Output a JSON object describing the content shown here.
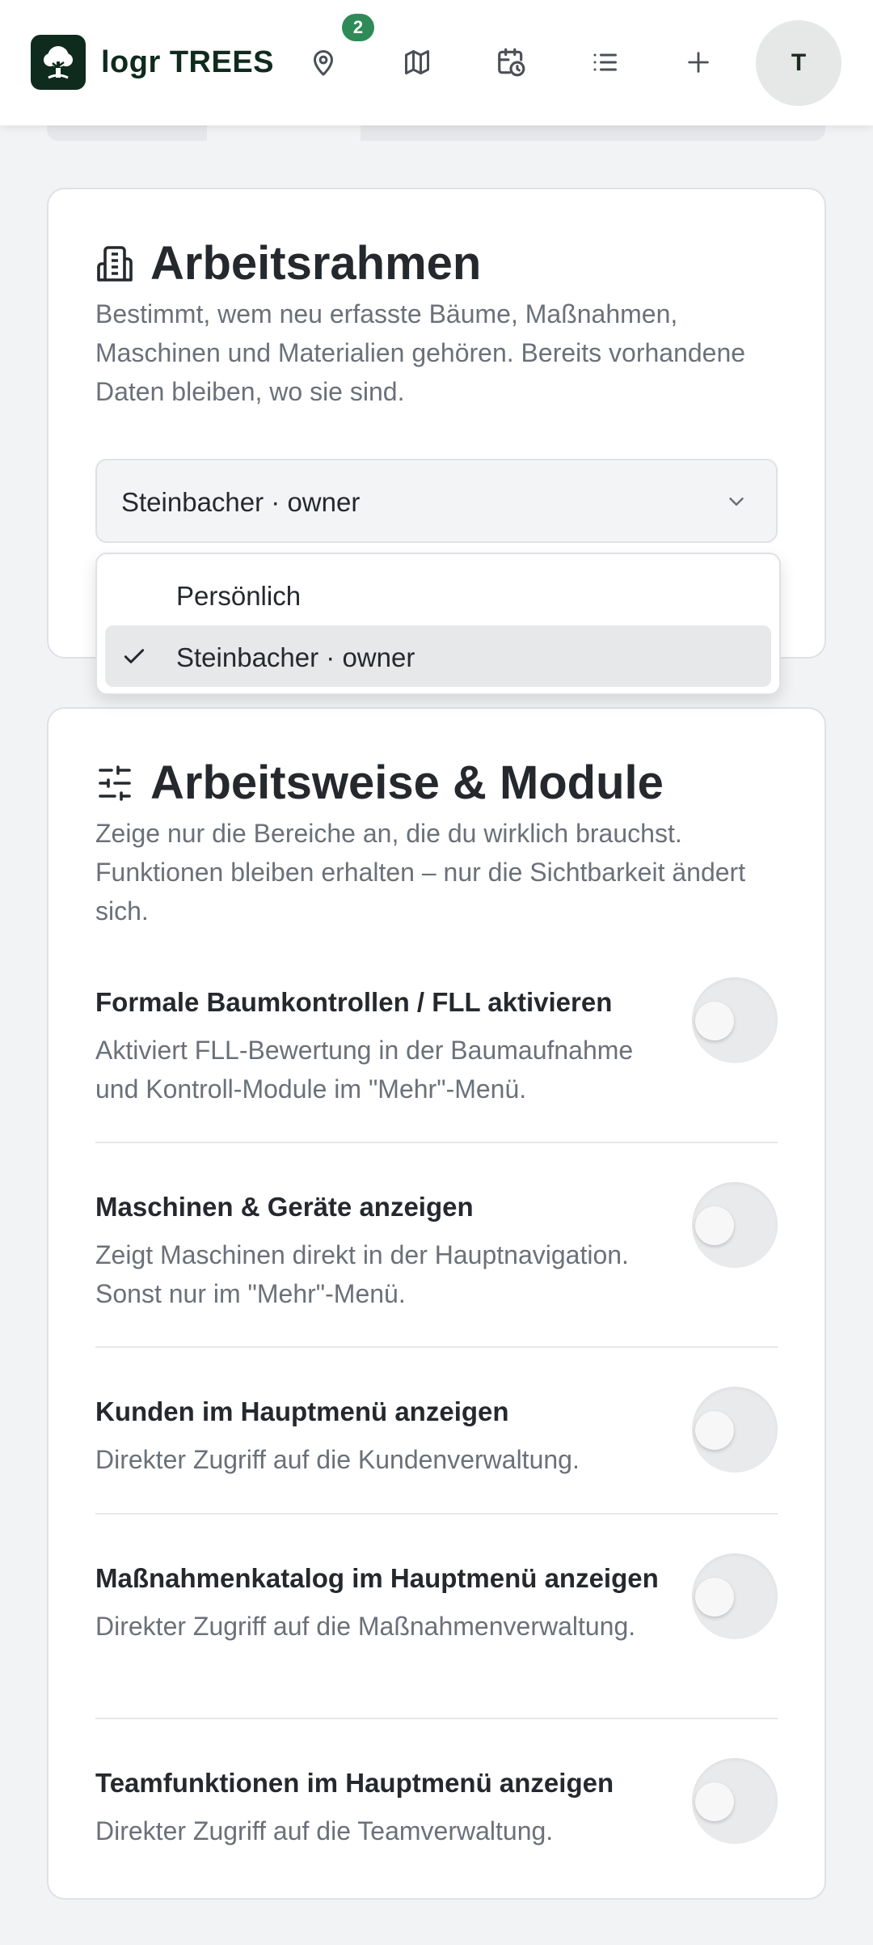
{
  "header": {
    "brand": "logr TREES",
    "badge_count": "2",
    "avatar_initial": "T",
    "nav_icons": [
      "map-pin-icon",
      "map-icon",
      "calendar-clock-icon",
      "list-icon",
      "plus-icon"
    ]
  },
  "workspace": {
    "title": "Arbeitsrahmen",
    "description": "Bestimmt, wem neu erfasste Bäume, Maßnahmen, Maschinen und Materialien gehören. Bereits vorhandene Daten bleiben, wo sie sind.",
    "select_value": "Steinbacher · owner",
    "options": [
      {
        "label": "Persönlich",
        "selected": false
      },
      {
        "label": "Steinbacher · owner",
        "selected": true
      }
    ]
  },
  "modules": {
    "title": "Arbeitsweise & Module",
    "description": "Zeige nur die Bereiche an, die du wirklich brauchst. Funktionen bleiben erhalten – nur die Sichtbarkeit ändert sich.",
    "settings": [
      {
        "title": "Formale Baumkontrollen / FLL aktivieren",
        "description": "Aktiviert FLL-Bewertung in der Baumaufnahme und Kontroll-Module im \"Mehr\"-Menü.",
        "enabled": false
      },
      {
        "title": "Maschinen & Geräte anzeigen",
        "description": "Zeigt Maschinen direkt in der Hauptnavigation. Sonst nur im \"Mehr\"-Menü.",
        "enabled": false
      },
      {
        "title": "Kunden im Hauptmenü anzeigen",
        "description": "Direkter Zugriff auf die Kundenverwaltung.",
        "enabled": false
      },
      {
        "title": "Maßnahmenkatalog im Hauptmenü anzeigen",
        "description": "Direkter Zugriff auf die Maßnahmenverwaltung.",
        "enabled": false
      },
      {
        "title": "Teamfunktionen im Hauptmenü anzeigen",
        "description": "Direkter Zugriff auf die Teamverwaltung.",
        "enabled": false
      }
    ]
  },
  "colors": {
    "brand_dark": "#0f2b1d",
    "badge_green": "#2e8b57",
    "text_primary": "#25282d",
    "text_secondary": "#6b7079"
  }
}
